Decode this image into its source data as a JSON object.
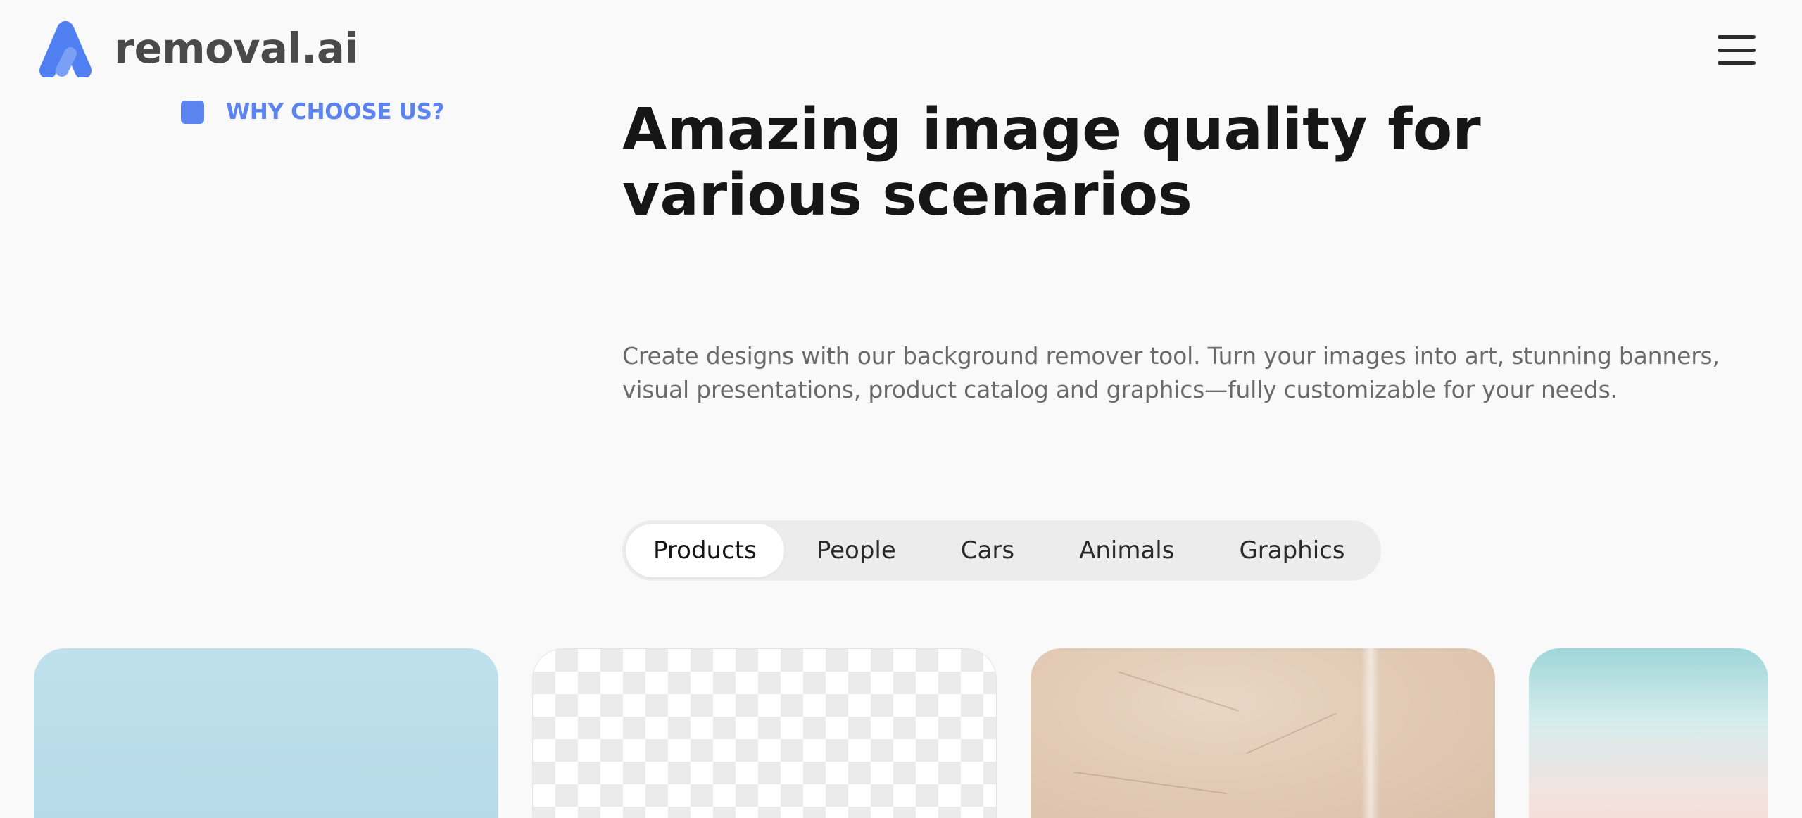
{
  "header": {
    "brand": "removal.ai",
    "logo_icon": "removal-ai-logo-icon",
    "menu_icon": "hamburger-menu-icon"
  },
  "section": {
    "eyebrow": "WHY CHOOSE US?",
    "title": "Amazing image quality for various scenarios",
    "description": "Create designs with our background remover tool. Turn your images into art, stunning banners, visual presentations, product catalog and graphics—fully customizable for your needs."
  },
  "tabs": [
    {
      "label": "Products",
      "active": true
    },
    {
      "label": "People",
      "active": false
    },
    {
      "label": "Cars",
      "active": false
    },
    {
      "label": "Animals",
      "active": false
    },
    {
      "label": "Graphics",
      "active": false
    }
  ],
  "colors": {
    "accent": "#5b84f0",
    "background": "#f9f9f9",
    "heading": "#161616",
    "body_text": "#6a6a6a"
  }
}
